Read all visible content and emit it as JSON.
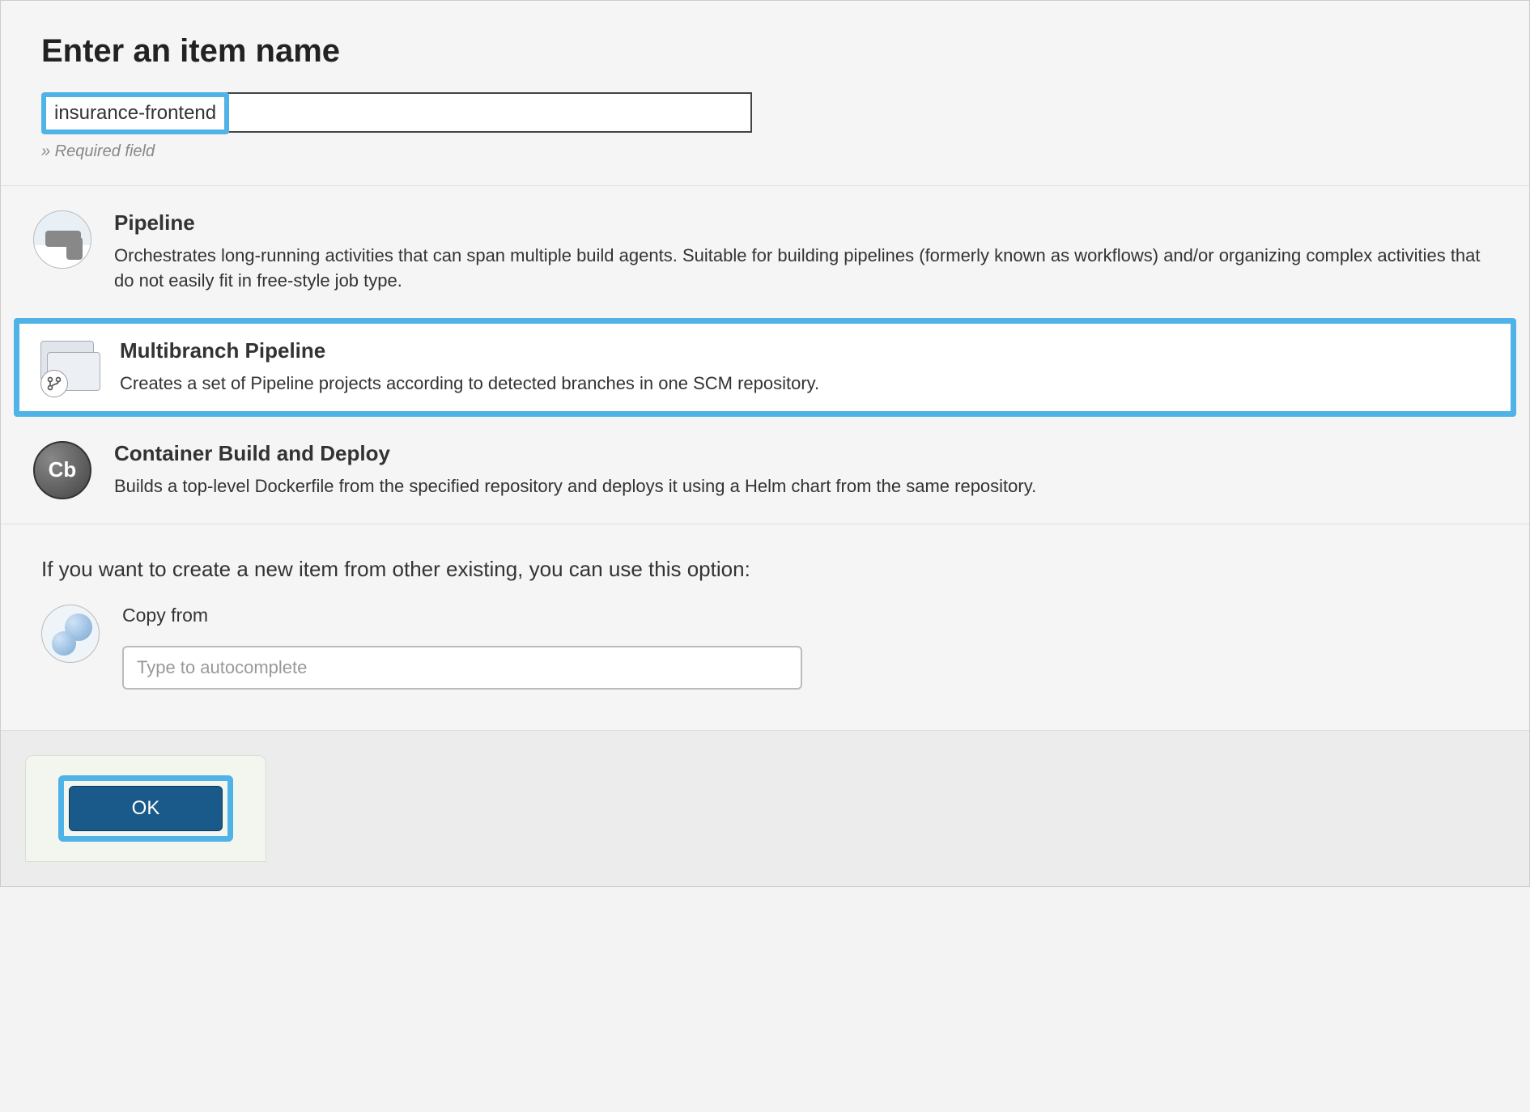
{
  "header": {
    "title": "Enter an item name",
    "item_name_value": "insurance-frontend",
    "required_hint": "» Required field"
  },
  "job_types": [
    {
      "title": "Pipeline",
      "description": "Orchestrates long-running activities that can span multiple build agents. Suitable for building pipelines (formerly known as workflows) and/or organizing complex activities that do not easily fit in free-style job type.",
      "selected": false
    },
    {
      "title": "Multibranch Pipeline",
      "description": "Creates a set of Pipeline projects according to detected branches in one SCM repository.",
      "selected": true
    },
    {
      "title": "Container Build and Deploy",
      "description": "Builds a top-level Dockerfile from the specified repository and deploys it using a Helm chart from the same repository.",
      "selected": false
    }
  ],
  "copy": {
    "prompt": "If you want to create a new item from other existing, you can use this option:",
    "label": "Copy from",
    "placeholder": "Type to autocomplete",
    "value": ""
  },
  "footer": {
    "ok_label": "OK"
  },
  "cb_icon_text": "Cb"
}
